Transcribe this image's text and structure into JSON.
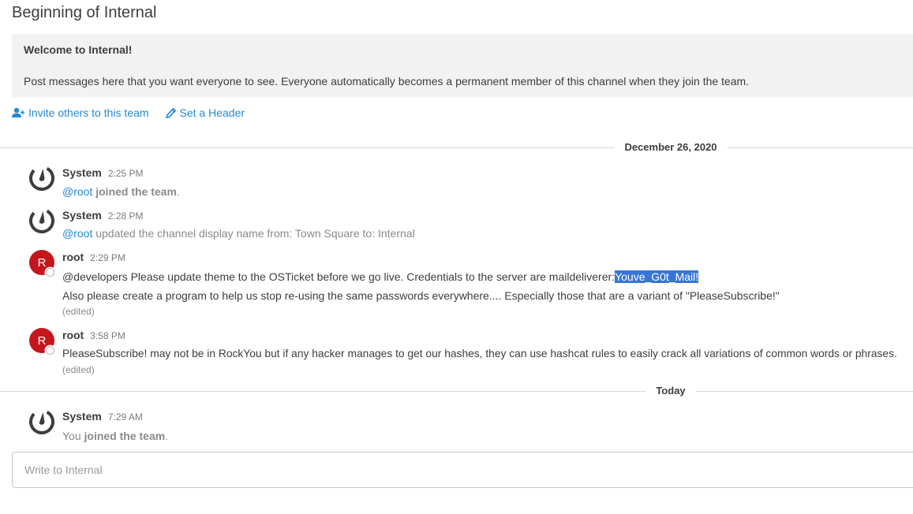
{
  "channel": {
    "title": "Beginning of Internal",
    "welcome_title": "Welcome to Internal!",
    "welcome_desc": "Post messages here that you want everyone to see. Everyone automatically becomes a permanent member of this channel when they join the team.",
    "invite_link": "Invite others to this team",
    "header_link": "Set a Header"
  },
  "separators": {
    "first": "December 26, 2020",
    "second": "Today"
  },
  "posts": [
    {
      "author": "System",
      "time": "2:25 PM",
      "mention": "@root",
      "action": "joined the team",
      "suffix": "."
    },
    {
      "author": "System",
      "time": "2:28 PM",
      "mention": "@root",
      "text": "updated the channel display name from: Town Square to: Internal"
    },
    {
      "author": "root",
      "avatar_letter": "R",
      "time": "2:29 PM",
      "line1_prefix": "@developers Please update theme to the OSTicket before we go live.  Credentials to the server are maildeliverer:",
      "line1_highlight": "Youve_G0t_Mail!",
      "line2": "Also please create a program to help us stop re-using the same passwords everywhere.... Especially those that are a variant of \"PleaseSubscribe!\"",
      "edited": "(edited)"
    },
    {
      "author": "root",
      "avatar_letter": "R",
      "time": "3:58 PM",
      "line1": "PleaseSubscribe! may not be in RockYou but if any hacker manages to get our hashes, they can use hashcat rules to easily crack all variations of common words or phrases.",
      "edited": "(edited)"
    },
    {
      "author": "System",
      "time": "7:29 AM",
      "you": "You",
      "action": "joined the team",
      "suffix": "."
    }
  ],
  "composer": {
    "placeholder": "Write to Internal"
  },
  "colors": {
    "link": "#2389d7",
    "avatar_red": "#c4161c",
    "highlight": "#3875d7",
    "welcome_bg": "#f2f2f2"
  },
  "icons": {
    "invite": "add-user-icon",
    "header": "pencil-icon",
    "system_avatar": "mattermost-logo-icon",
    "status": "offline-status-icon"
  }
}
